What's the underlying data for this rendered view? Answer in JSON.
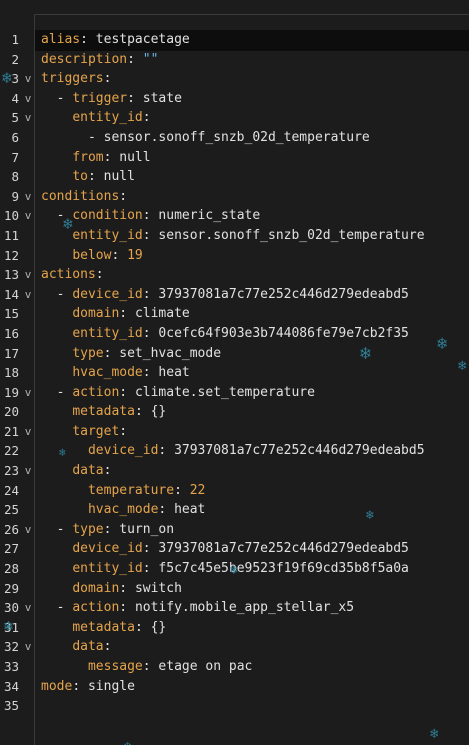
{
  "editor": {
    "lines": [
      {
        "n": "1",
        "fold": "",
        "indent": "",
        "dash": "",
        "key": "alias",
        "sep": ": ",
        "val": "testpacetage",
        "vtype": "val"
      },
      {
        "n": "2",
        "fold": "",
        "indent": "",
        "dash": "",
        "key": "description",
        "sep": ": ",
        "val": "\"\"",
        "vtype": "str"
      },
      {
        "n": "3",
        "fold": "v",
        "indent": "",
        "dash": "",
        "key": "triggers",
        "sep": ":",
        "val": "",
        "vtype": "val"
      },
      {
        "n": "4",
        "fold": "v",
        "indent": "  ",
        "dash": "- ",
        "key": "trigger",
        "sep": ": ",
        "val": "state",
        "vtype": "val"
      },
      {
        "n": "5",
        "fold": "v",
        "indent": "    ",
        "dash": "",
        "key": "entity_id",
        "sep": ":",
        "val": "",
        "vtype": "val"
      },
      {
        "n": "6",
        "fold": "",
        "indent": "      ",
        "dash": "- ",
        "key": "",
        "sep": "",
        "val": "sensor.sonoff_snzb_02d_temperature",
        "vtype": "val"
      },
      {
        "n": "7",
        "fold": "",
        "indent": "    ",
        "dash": "",
        "key": "from",
        "sep": ": ",
        "val": "null",
        "vtype": "val"
      },
      {
        "n": "8",
        "fold": "",
        "indent": "    ",
        "dash": "",
        "key": "to",
        "sep": ": ",
        "val": "null",
        "vtype": "val"
      },
      {
        "n": "9",
        "fold": "v",
        "indent": "",
        "dash": "",
        "key": "conditions",
        "sep": ":",
        "val": "",
        "vtype": "val"
      },
      {
        "n": "10",
        "fold": "v",
        "indent": "  ",
        "dash": "- ",
        "key": "condition",
        "sep": ": ",
        "val": "numeric_state",
        "vtype": "val"
      },
      {
        "n": "11",
        "fold": "",
        "indent": "    ",
        "dash": "",
        "key": "entity_id",
        "sep": ": ",
        "val": "sensor.sonoff_snzb_02d_temperature",
        "vtype": "val"
      },
      {
        "n": "12",
        "fold": "",
        "indent": "    ",
        "dash": "",
        "key": "below",
        "sep": ": ",
        "val": "19",
        "vtype": "num"
      },
      {
        "n": "13",
        "fold": "v",
        "indent": "",
        "dash": "",
        "key": "actions",
        "sep": ":",
        "val": "",
        "vtype": "val"
      },
      {
        "n": "14",
        "fold": "v",
        "indent": "  ",
        "dash": "- ",
        "key": "device_id",
        "sep": ": ",
        "val": "37937081a7c77e252c446d279edeabd5",
        "vtype": "val"
      },
      {
        "n": "15",
        "fold": "",
        "indent": "    ",
        "dash": "",
        "key": "domain",
        "sep": ": ",
        "val": "climate",
        "vtype": "val"
      },
      {
        "n": "16",
        "fold": "",
        "indent": "    ",
        "dash": "",
        "key": "entity_id",
        "sep": ": ",
        "val": "0cefc64f903e3b744086fe79e7cb2f35",
        "vtype": "val"
      },
      {
        "n": "17",
        "fold": "",
        "indent": "    ",
        "dash": "",
        "key": "type",
        "sep": ": ",
        "val": "set_hvac_mode",
        "vtype": "val"
      },
      {
        "n": "18",
        "fold": "",
        "indent": "    ",
        "dash": "",
        "key": "hvac_mode",
        "sep": ": ",
        "val": "heat",
        "vtype": "val"
      },
      {
        "n": "19",
        "fold": "v",
        "indent": "  ",
        "dash": "- ",
        "key": "action",
        "sep": ": ",
        "val": "climate.set_temperature",
        "vtype": "val"
      },
      {
        "n": "20",
        "fold": "",
        "indent": "    ",
        "dash": "",
        "key": "metadata",
        "sep": ": ",
        "val": "{}",
        "vtype": "val"
      },
      {
        "n": "21",
        "fold": "v",
        "indent": "    ",
        "dash": "",
        "key": "target",
        "sep": ":",
        "val": "",
        "vtype": "val"
      },
      {
        "n": "22",
        "fold": "",
        "indent": "      ",
        "dash": "",
        "key": "device_id",
        "sep": ": ",
        "val": "37937081a7c77e252c446d279edeabd5",
        "vtype": "val"
      },
      {
        "n": "23",
        "fold": "v",
        "indent": "    ",
        "dash": "",
        "key": "data",
        "sep": ":",
        "val": "",
        "vtype": "val"
      },
      {
        "n": "24",
        "fold": "",
        "indent": "      ",
        "dash": "",
        "key": "temperature",
        "sep": ": ",
        "val": "22",
        "vtype": "num"
      },
      {
        "n": "25",
        "fold": "",
        "indent": "      ",
        "dash": "",
        "key": "hvac_mode",
        "sep": ": ",
        "val": "heat",
        "vtype": "val"
      },
      {
        "n": "26",
        "fold": "v",
        "indent": "  ",
        "dash": "- ",
        "key": "type",
        "sep": ": ",
        "val": "turn_on",
        "vtype": "val"
      },
      {
        "n": "27",
        "fold": "",
        "indent": "    ",
        "dash": "",
        "key": "device_id",
        "sep": ": ",
        "val": "37937081a7c77e252c446d279edeabd5",
        "vtype": "val"
      },
      {
        "n": "28",
        "fold": "",
        "indent": "    ",
        "dash": "",
        "key": "entity_id",
        "sep": ": ",
        "val": "f5c7c45e5be9523f19f69cd35b8f5a0a",
        "vtype": "val"
      },
      {
        "n": "29",
        "fold": "",
        "indent": "    ",
        "dash": "",
        "key": "domain",
        "sep": ": ",
        "val": "switch",
        "vtype": "val"
      },
      {
        "n": "30",
        "fold": "v",
        "indent": "  ",
        "dash": "- ",
        "key": "action",
        "sep": ": ",
        "val": "notify.mobile_app_stellar_x5",
        "vtype": "val"
      },
      {
        "n": "31",
        "fold": "",
        "indent": "    ",
        "dash": "",
        "key": "metadata",
        "sep": ": ",
        "val": "{}",
        "vtype": "val"
      },
      {
        "n": "32",
        "fold": "v",
        "indent": "    ",
        "dash": "",
        "key": "data",
        "sep": ":",
        "val": "",
        "vtype": "val"
      },
      {
        "n": "33",
        "fold": "",
        "indent": "      ",
        "dash": "",
        "key": "message",
        "sep": ": ",
        "val": "etage on pac",
        "vtype": "val"
      },
      {
        "n": "34",
        "fold": "",
        "indent": "",
        "dash": "",
        "key": "mode",
        "sep": ": ",
        "val": "single",
        "vtype": "val"
      },
      {
        "n": "35",
        "fold": "",
        "indent": "",
        "dash": "",
        "key": "",
        "sep": "",
        "val": "",
        "vtype": "val"
      }
    ]
  },
  "colors": {
    "background": "#1c1c1c",
    "key": "#e5a44c",
    "string": "#6cb6e6",
    "number": "#e5a44c",
    "text": "#e1e1e1",
    "snowflake": "#2f7c93"
  },
  "decorations": {
    "snowflake_icon": "snowflake-icon",
    "snowflake_glyph": "❄"
  }
}
